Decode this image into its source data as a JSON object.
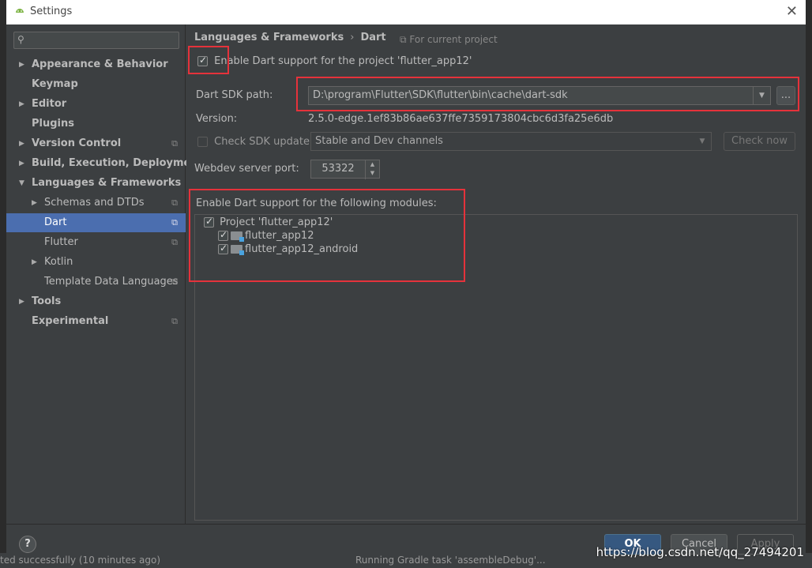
{
  "window": {
    "title": "Settings"
  },
  "sidebar": {
    "search_placeholder": "",
    "items": [
      {
        "label": "Appearance & Behavior",
        "level": 0,
        "expandable": true,
        "bold": true
      },
      {
        "label": "Keymap",
        "level": 0,
        "expandable": false,
        "bold": true
      },
      {
        "label": "Editor",
        "level": 0,
        "expandable": true,
        "bold": true
      },
      {
        "label": "Plugins",
        "level": 0,
        "expandable": false,
        "bold": true
      },
      {
        "label": "Version Control",
        "level": 0,
        "expandable": true,
        "bold": true,
        "project_scope": true
      },
      {
        "label": "Build, Execution, Deployment",
        "level": 0,
        "expandable": true,
        "bold": true
      },
      {
        "label": "Languages & Frameworks",
        "level": 0,
        "expanded": true,
        "bold": true
      },
      {
        "label": "Schemas and DTDs",
        "level": 1,
        "expandable": true,
        "project_scope": true
      },
      {
        "label": "Dart",
        "level": 1,
        "selected": true,
        "project_scope": true
      },
      {
        "label": "Flutter",
        "level": 1,
        "project_scope": true
      },
      {
        "label": "Kotlin",
        "level": 1,
        "expandable": true
      },
      {
        "label": "Template Data Languages",
        "level": 1,
        "project_scope": true
      },
      {
        "label": "Tools",
        "level": 0,
        "expandable": true,
        "bold": true
      },
      {
        "label": "Experimental",
        "level": 0,
        "bold": true,
        "project_scope": true
      }
    ]
  },
  "content": {
    "breadcrumb": [
      "Languages & Frameworks",
      "Dart"
    ],
    "scope_label": "For current project",
    "enable_dart": {
      "label": "Enable Dart support for the project 'flutter_app12'",
      "checked": true
    },
    "sdk_path": {
      "label": "Dart SDK path:",
      "value": "D:\\program\\Flutter\\SDK\\flutter\\bin\\cache\\dart-sdk",
      "browse_label": "..."
    },
    "version": {
      "label": "Version:",
      "value": "2.5.0-edge.1ef83b86ae637ffe7359173804cbc6d3fa25e6db"
    },
    "check_update": {
      "label": "Check SDK update:",
      "checked": false,
      "channel": "Stable and Dev channels",
      "button": "Check now"
    },
    "webdev": {
      "label": "Webdev server port:",
      "value": "53322"
    },
    "modules": {
      "label": "Enable Dart support for the following modules:",
      "project": {
        "label": "Project 'flutter_app12'",
        "checked": true
      },
      "items": [
        {
          "label": "flutter_app12",
          "checked": true
        },
        {
          "label": "flutter_app12_android",
          "checked": true
        }
      ]
    }
  },
  "footer": {
    "help": "?",
    "ok": "OK",
    "cancel": "Cancel",
    "apply": "Apply"
  },
  "ide_status": {
    "left_text": "ted successfully (10 minutes ago)",
    "center_text": "Running Gradle task 'assembleDebug'..."
  },
  "watermark": "https://blog.csdn.net/qq_27494201",
  "colors": {
    "accent": "#4b6eaf",
    "highlight_box": "#e5323b",
    "ok_button": "#365880"
  }
}
